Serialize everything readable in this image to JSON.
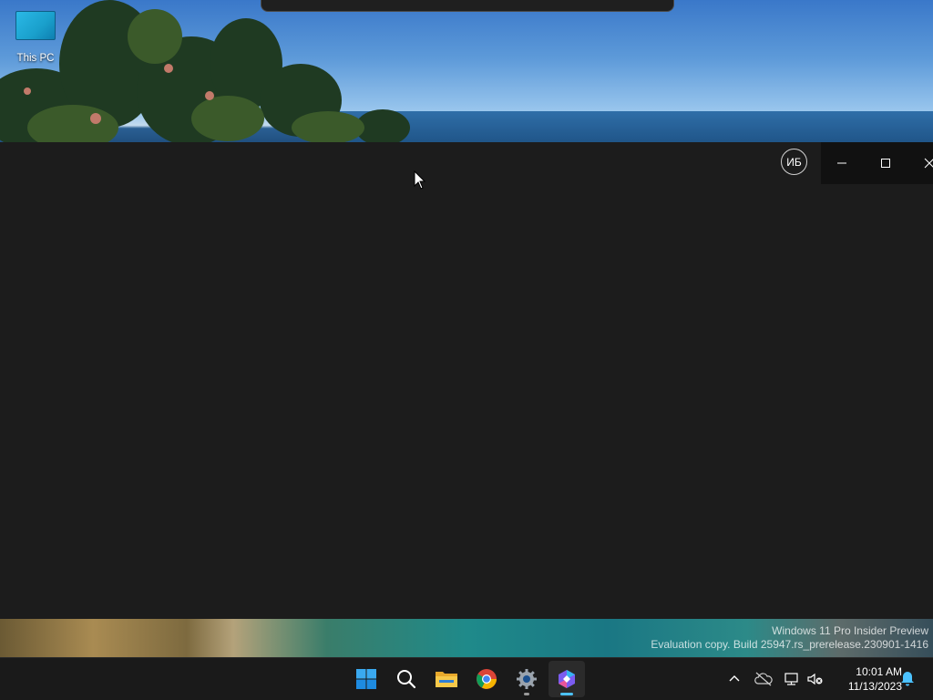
{
  "desktop": {
    "icons": [
      {
        "label": "This PC"
      }
    ]
  },
  "window": {
    "avatar_initials": "ИБ",
    "minimize_label": "Minimize",
    "maximize_label": "Maximize",
    "close_label": "Close"
  },
  "watermark": {
    "line1": "Windows 11 Pro Insider Preview",
    "line2": "Evaluation copy. Build 25947.rs_prerelease.230901-1416"
  },
  "taskbar": {
    "apps": [
      {
        "name": "Start",
        "icon": "windows-logo-icon"
      },
      {
        "name": "Search",
        "icon": "search-icon"
      },
      {
        "name": "File Explorer",
        "icon": "folder-icon"
      },
      {
        "name": "Google Chrome",
        "icon": "chrome-icon"
      },
      {
        "name": "Settings",
        "icon": "gear-icon"
      },
      {
        "name": "Bing / Copilot",
        "icon": "copilot-icon"
      }
    ],
    "tray": {
      "time": "10:01 AM",
      "date": "11/13/2023"
    }
  },
  "colors": {
    "accent": "#4cc2ff",
    "window_bg": "#1c1c1c",
    "taskbar_bg": "#1a1a1a"
  }
}
